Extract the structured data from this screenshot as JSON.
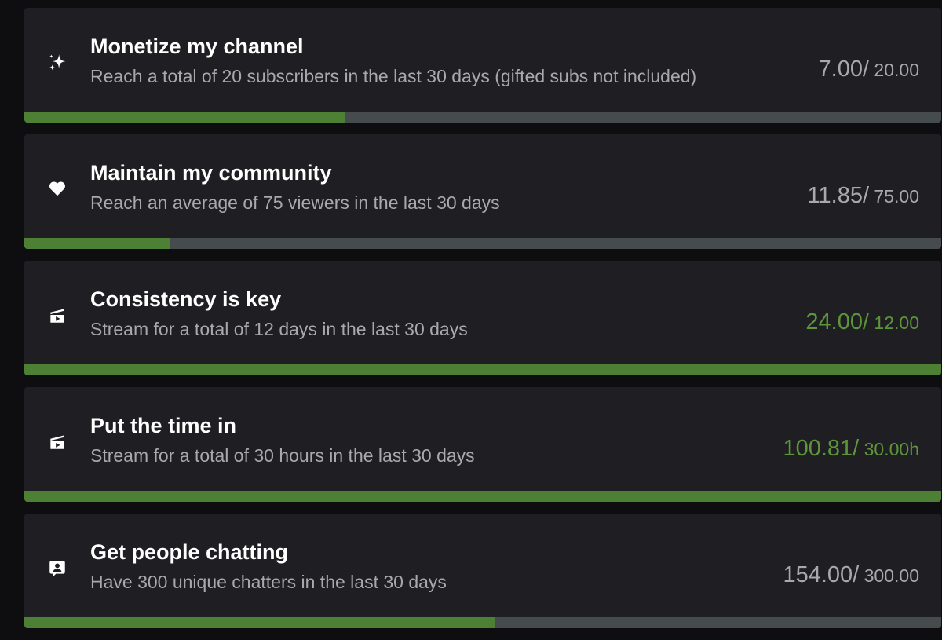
{
  "goals": [
    {
      "icon": "sparkle-icon",
      "title": "Monetize my channel",
      "description": "Reach a total of 20 subscribers in the last 30 days (gifted subs not included)",
      "current": "7.00/",
      "target": " 20.00",
      "progress": 0.35,
      "complete": false
    },
    {
      "icon": "heart-icon",
      "title": "Maintain my community",
      "description": "Reach an average of 75 viewers in the last 30 days",
      "current": "11.85/",
      "target": " 75.00",
      "progress": 0.158,
      "complete": false
    },
    {
      "icon": "stream-icon",
      "title": "Consistency is key",
      "description": "Stream for a total of 12 days in the last 30 days",
      "current": "24.00/",
      "target": " 12.00",
      "progress": 1.0,
      "complete": true
    },
    {
      "icon": "stream-icon",
      "title": "Put the time in",
      "description": "Stream for a total of 30 hours in the last 30 days",
      "current": "100.81/",
      "target": " 30.00h",
      "progress": 1.0,
      "complete": true
    },
    {
      "icon": "chat-icon",
      "title": "Get people chatting",
      "description": "Have 300 unique chatters in the last 30 days",
      "current": "154.00/",
      "target": " 300.00",
      "progress": 0.513,
      "complete": false
    }
  ],
  "colors": {
    "progress_fill": "#4d7f34",
    "progress_track": "#464b4e",
    "complete_text": "#5d953a",
    "card_background": "#1f1f23"
  }
}
